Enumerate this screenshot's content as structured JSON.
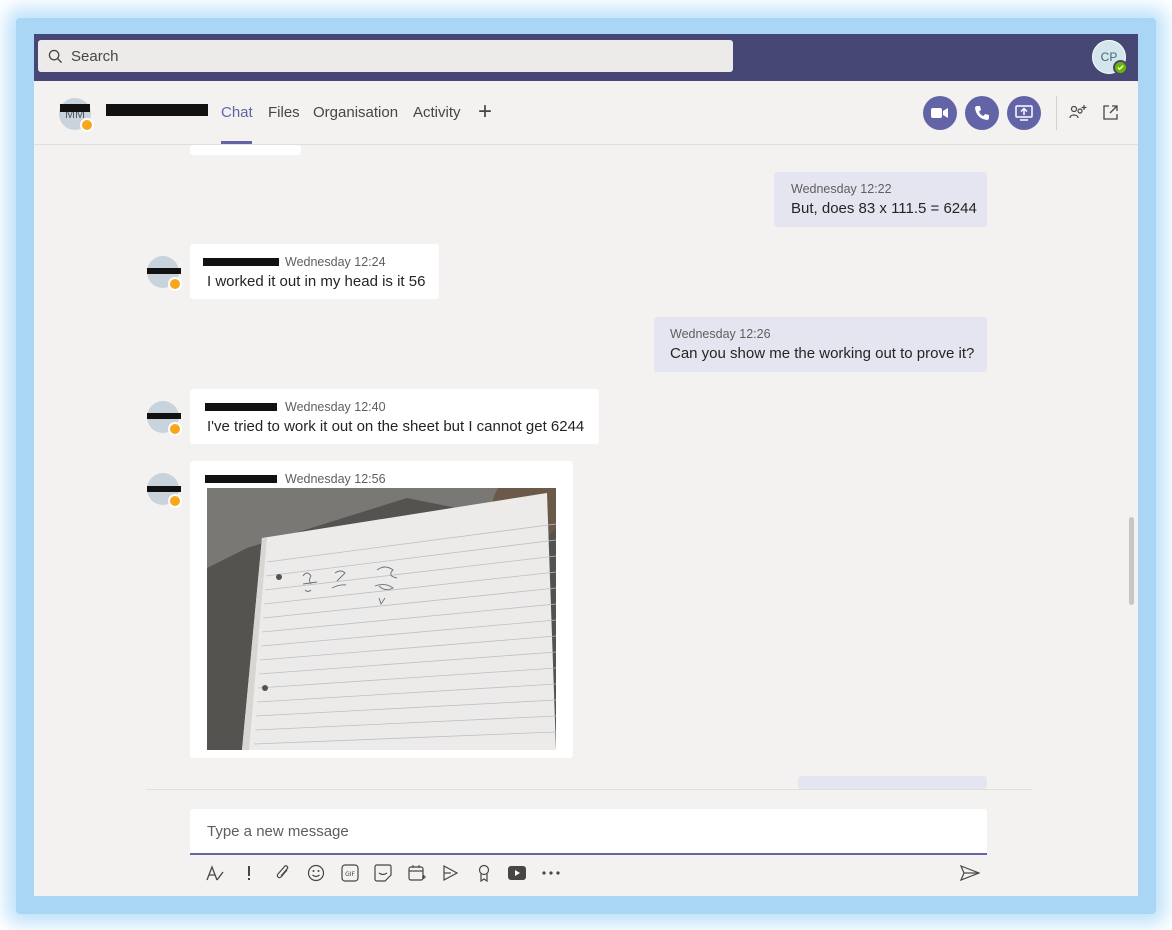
{
  "topbar": {
    "search_placeholder": "Search",
    "user_initials": "CP",
    "user_status": "available"
  },
  "header": {
    "contact_initials": "MM",
    "tabs": [
      {
        "label": "Chat",
        "active": true
      },
      {
        "label": "Files",
        "active": false
      },
      {
        "label": "Organisation",
        "active": false
      },
      {
        "label": "Activity",
        "active": false
      }
    ],
    "add_tab_icon": "plus-icon",
    "actions": [
      "video-call-icon",
      "audio-call-icon",
      "share-screen-icon",
      "add-people-icon",
      "pop-out-icon"
    ]
  },
  "messages": [
    {
      "mine": true,
      "time": "Wednesday 12:22",
      "text": "But, does 83 x 111.5 = 6244"
    },
    {
      "mine": false,
      "time": "Wednesday 12:24",
      "text": "I worked it out in my head is it 56"
    },
    {
      "mine": true,
      "time": "Wednesday 12:26",
      "text": "Can you show me the working out to prove it?"
    },
    {
      "mine": false,
      "time": "Wednesday 12:40",
      "text": "I've tried to work it out on the sheet but I cannot get 6244"
    },
    {
      "mine": false,
      "time": "Wednesday 12:56",
      "text": "",
      "attachment": "photo of handwritten working on lined paper"
    }
  ],
  "compose": {
    "placeholder": "Type a new message",
    "tools": [
      "format-icon",
      "important-icon",
      "attach-icon",
      "emoji-icon",
      "gif-icon",
      "sticker-icon",
      "schedule-meeting-icon",
      "stream-icon",
      "praise-icon",
      "youtube-icon",
      "more-icon"
    ],
    "send_icon": "send-icon"
  },
  "colors": {
    "brand": "#6264a7",
    "topbar": "#464775",
    "away": "#f8a71b",
    "available": "#6bb700"
  }
}
